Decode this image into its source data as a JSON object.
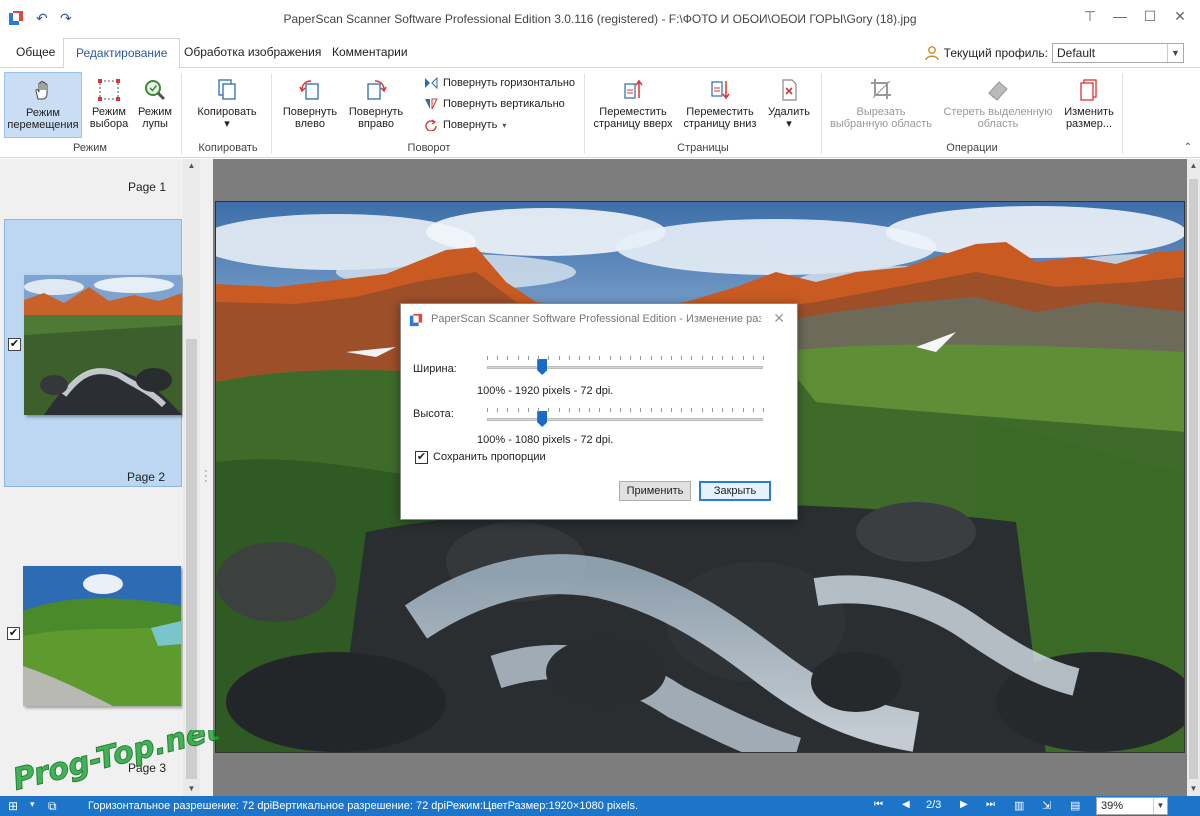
{
  "window": {
    "title": "PaperScan Scanner Software Professional Edition 3.0.116 (registered) - F:\\ФОТО И ОБОИ\\ОБОИ ГОРЫ\\Gory (18).jpg"
  },
  "tabs": [
    {
      "label": "Общее"
    },
    {
      "label": "Редактирование"
    },
    {
      "label": "Обработка изображения"
    },
    {
      "label": "Комментарии"
    }
  ],
  "profile": {
    "label": "Текущий профиль:",
    "value": "Default"
  },
  "ribbon": {
    "move_mode": {
      "line1": "Режим",
      "line2": "перемещения"
    },
    "select_mode": {
      "line1": "Режим",
      "line2": "выбора"
    },
    "zoom_mode": {
      "line1": "Режим",
      "line2": "лупы"
    },
    "copy": {
      "line1": "Копировать",
      "line2": "▾"
    },
    "rotate_left": {
      "line1": "Повернуть",
      "line2": "влево"
    },
    "rotate_right": {
      "line1": "Повернуть",
      "line2": "вправо"
    },
    "flip_h": "Повернуть горизонтально",
    "flip_v": "Повернуть вертикально",
    "rotate": "Повернуть",
    "move_up": {
      "line1": "Переместить",
      "line2": "страницу вверх"
    },
    "move_down": {
      "line1": "Переместить",
      "line2": "страницу вниз"
    },
    "delete": {
      "line1": "Удалить",
      "line2": "▾"
    },
    "crop": {
      "line1": "Вырезать",
      "line2": "выбранную область"
    },
    "erase": {
      "line1": "Стереть выделенную",
      "line2": "область"
    },
    "resize": {
      "line1": "Изменить",
      "line2": "размер..."
    },
    "groups": {
      "mode": "Режим",
      "copy": "Копировать",
      "rotation": "Поворот",
      "pages": "Страницы",
      "operations": "Операции"
    }
  },
  "pages": [
    {
      "label": "Page 1"
    },
    {
      "label": "Page 2"
    },
    {
      "label": "Page 3"
    }
  ],
  "dialog": {
    "title": "PaperScan Scanner Software Professional Edition - Изменение разме...",
    "width_label": "Ширина:",
    "width_value": "100% - 1920 pixels - 72 dpi.",
    "width_slider": 0.2,
    "height_label": "Высота:",
    "height_value": "100% - 1080 pixels - 72 dpi.",
    "height_slider": 0.2,
    "keep_ratio_label": "Сохранить пропорции",
    "keep_ratio_checked": true,
    "apply_label": "Применить",
    "close_label": "Закрыть"
  },
  "status": {
    "text": "Горизонтальное разрешение: 72 dpiВертикальное разрешение: 72 dpiРежим:ЦветРазмер:1920×1080 pixels.",
    "page_indicator": "2/3",
    "zoom": "39%"
  },
  "watermark": "Prog-Top.net"
}
